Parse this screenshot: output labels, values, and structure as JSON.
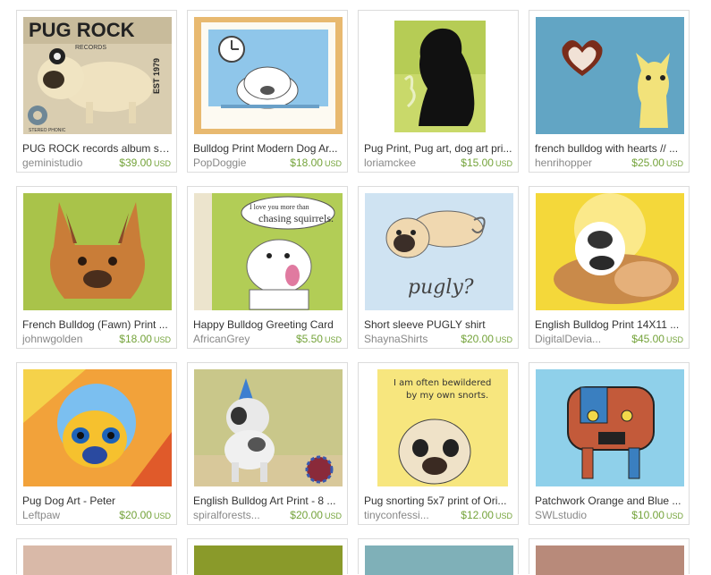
{
  "listings": [
    {
      "title": "PUG ROCK records album st...",
      "shop": "geministudio",
      "price": "$39.00",
      "currency": "USD",
      "art": "pug-rock",
      "lettering": [
        "PUG ROCK",
        "RECORDS",
        "EST 1979",
        "STEREO PHONIC"
      ]
    },
    {
      "title": "Bulldog Print Modern Dog Ar...",
      "shop": "PopDoggie",
      "price": "$18.00",
      "currency": "USD",
      "art": "bulldog-clock"
    },
    {
      "title": "Pug Print, Pug art, dog art pri...",
      "shop": "loriamckee",
      "price": "$15.00",
      "currency": "USD",
      "art": "pug-silhouette"
    },
    {
      "title": "french bulldog with hearts // ...",
      "shop": "henrihopper",
      "price": "$25.00",
      "currency": "USD",
      "art": "frenchie-heart"
    },
    {
      "title": "French Bulldog (Fawn) Print ...",
      "shop": "johnwgolden",
      "price": "$18.00",
      "currency": "USD",
      "art": "frenchie-fawn"
    },
    {
      "title": "Happy Bulldog Greeting Card",
      "shop": "AfricanGrey",
      "price": "$5.50",
      "currency": "USD",
      "art": "happy-bulldog",
      "lettering": [
        "I love you more than",
        "chasing squirrels."
      ]
    },
    {
      "title": "Short sleeve PUGLY shirt",
      "shop": "ShaynaShirts",
      "price": "$20.00",
      "currency": "USD",
      "art": "pugly",
      "lettering": [
        "pugly?"
      ]
    },
    {
      "title": "English Bulldog Print 14X11 ...",
      "shop": "DigitalDevia...",
      "price": "$45.00",
      "currency": "USD",
      "art": "english-bulldog"
    },
    {
      "title": "Pug Dog Art - Peter",
      "shop": "Leftpaw",
      "price": "$20.00",
      "currency": "USD",
      "art": "pug-pop"
    },
    {
      "title": "English Bulldog Art Print - 8 ...",
      "shop": "spiralforests...",
      "price": "$20.00",
      "currency": "USD",
      "art": "bulldog-party"
    },
    {
      "title": "Pug snorting 5x7 print of Ori...",
      "shop": "tinyconfessi...",
      "price": "$12.00",
      "currency": "USD",
      "art": "pug-snort",
      "lettering": [
        "I am often bewildered",
        "by my own snorts."
      ]
    },
    {
      "title": "Patchwork Orange and Blue ...",
      "shop": "SWLstudio",
      "price": "$10.00",
      "currency": "USD",
      "art": "patchwork-pug"
    }
  ],
  "colors": {
    "price": "#74a33a",
    "border": "#dcdcdc",
    "shop": "#888888",
    "title": "#333333"
  }
}
